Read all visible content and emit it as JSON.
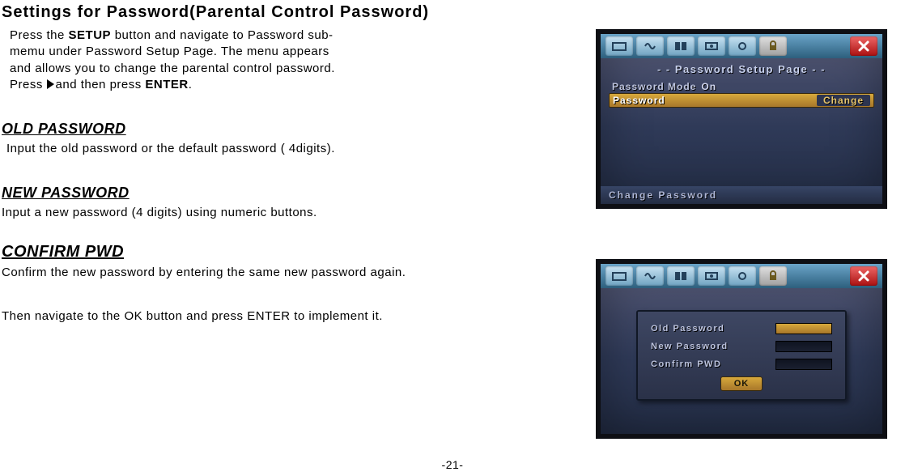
{
  "title": "Settings for Password(Parental Control Password)",
  "intro": {
    "l1a": "Press the ",
    "l1b": "SETUP",
    "l1c": " button and navigate to Password sub-",
    "l2": "memu under  Password Setup Page. The menu appears",
    "l3": "and allows you to change the parental control password.",
    "l4a": "Press",
    "l4b": "and then press ",
    "l4c": "ENTER",
    "l4d": "."
  },
  "old": {
    "head": "OLD PASSWORD",
    "body": "Input the old password or the default password ( 4digits)."
  },
  "new": {
    "head": "NEW PASSWORD",
    "body": "Input a new password (4 digits) using numeric buttons."
  },
  "confirm": {
    "head": "CONFIRM PWD",
    "body": "Confirm  the  new  password by entering the same new password  again."
  },
  "then": {
    "a": "Then  navigate  to  the ",
    "b": "OK",
    "c": " button and press ",
    "d": "ENTER",
    "e": " to implement it."
  },
  "fig1": {
    "heading": "- -   Password  Setup  Page   - -",
    "row1_label": "Password  Mode",
    "row1_value": "On",
    "row2_label": "Password",
    "row2_value": "Change",
    "status": "Change  Password"
  },
  "fig2": {
    "r1": "Old  Password",
    "r2": "New  Password",
    "r3": "Confirm  PWD",
    "ok": "OK"
  },
  "page_num": "-21-"
}
